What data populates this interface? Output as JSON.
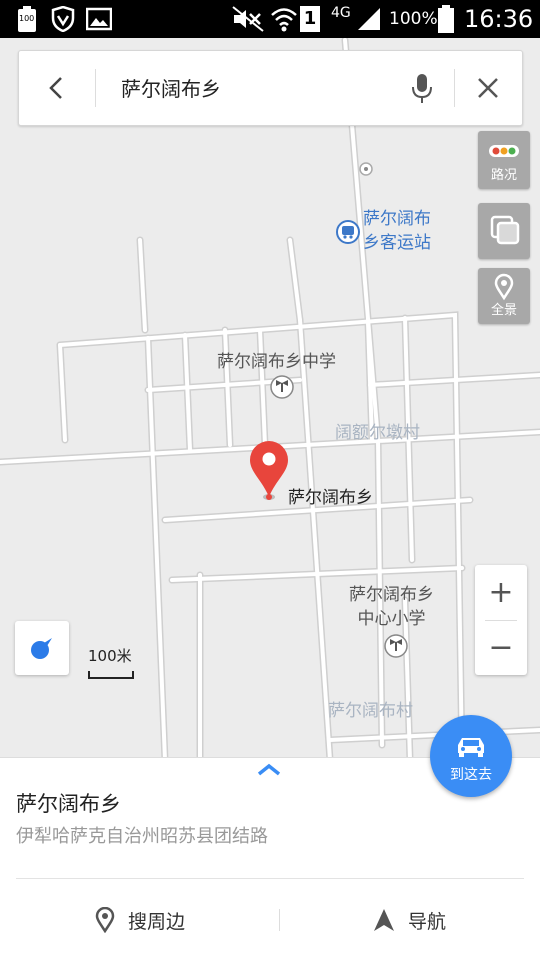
{
  "status_bar": {
    "battery_small": "100",
    "network": "4G",
    "sim_slot": "1",
    "battery_pct": "100%",
    "time": "16:36",
    "icons": [
      "battery-icon",
      "shield-icon",
      "image-icon",
      "mute-icon",
      "wifi-icon",
      "sim-icon",
      "signal-icon",
      "battery-full-icon"
    ]
  },
  "search": {
    "query": "萨尔阔布乡",
    "icons": [
      "back-icon",
      "mic-icon",
      "close-icon"
    ]
  },
  "map": {
    "labels": {
      "bus_station": "萨尔阔布\n乡客运站",
      "middle_school": "萨尔阔布乡中学",
      "village_road": "阔额尔墩村",
      "center_place": "萨尔阔布乡",
      "primary_school": "萨尔阔布乡\n中心小学",
      "village": "萨尔阔布村"
    },
    "controls": {
      "traffic": "路况",
      "layers_icon": "layers-icon",
      "panorama": "全景"
    },
    "scale": "100米",
    "zoom_in": "+",
    "zoom_out": "−"
  },
  "route_button": "到这去",
  "panel": {
    "title": "萨尔阔布乡",
    "address": "伊犁哈萨克自治州昭苏县团结路",
    "nearby": "搜周边",
    "navigate": "导航"
  },
  "colors": {
    "accent_blue": "#3a8df5",
    "poi_blue": "#3d78c8",
    "marker_red": "#e8453c",
    "map_bg": "#ececec"
  }
}
